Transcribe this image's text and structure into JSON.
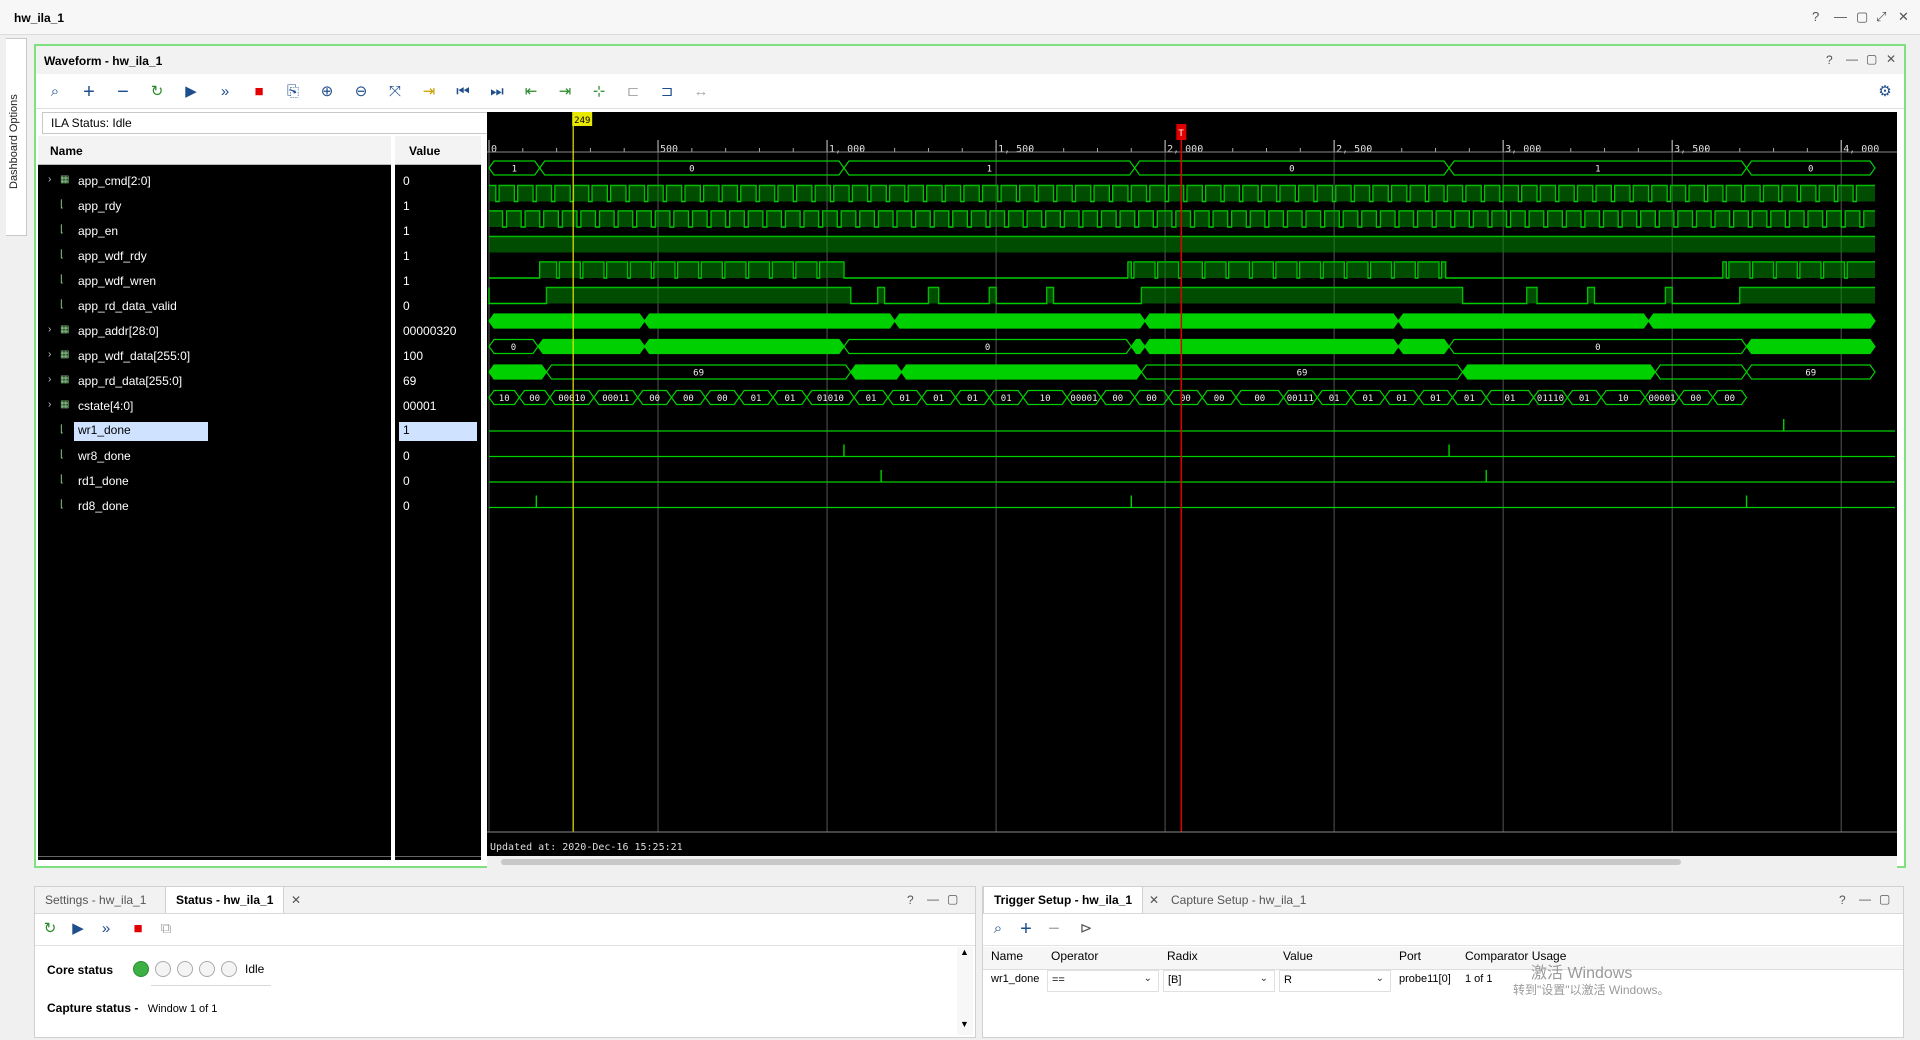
{
  "window": {
    "title": "hw_ila_1"
  },
  "sidebar": {
    "dashboard_tab": "Dashboard Options"
  },
  "waveform": {
    "panel_title": "Waveform - hw_ila_1",
    "ila_status": "ILA Status:  Idle",
    "name_header": "Name",
    "value_header": "Value",
    "signals": [
      {
        "name": "app_cmd[2:0]",
        "value": "0",
        "bus": true
      },
      {
        "name": "app_rdy",
        "value": "1",
        "bus": false
      },
      {
        "name": "app_en",
        "value": "1",
        "bus": false
      },
      {
        "name": "app_wdf_rdy",
        "value": "1",
        "bus": false
      },
      {
        "name": "app_wdf_wren",
        "value": "1",
        "bus": false
      },
      {
        "name": "app_rd_data_valid",
        "value": "0",
        "bus": false
      },
      {
        "name": "app_addr[28:0]",
        "value": "00000320",
        "bus": true
      },
      {
        "name": "app_wdf_data[255:0]",
        "value": "100",
        "bus": true
      },
      {
        "name": "app_rd_data[255:0]",
        "value": "69",
        "bus": true
      },
      {
        "name": "cstate[4:0]",
        "value": "00001",
        "bus": true
      },
      {
        "name": "wr1_done",
        "value": "1",
        "bus": false,
        "selected": true
      },
      {
        "name": "wr8_done",
        "value": "0",
        "bus": false
      },
      {
        "name": "rd1_done",
        "value": "0",
        "bus": false
      },
      {
        "name": "rd8_done",
        "value": "0",
        "bus": false
      }
    ],
    "time_ticks": [
      "0",
      "500",
      "1, 000",
      "1, 500",
      "2, 000",
      "2, 500",
      "3, 000",
      "3, 500",
      "4, 000"
    ],
    "cursor_marker": "249",
    "trigger_marker": "T",
    "updated_at": "Updated at: 2020-Dec-16 15:25:21",
    "bus_labels": {
      "app_cmd": [
        "1",
        "0",
        "1",
        "0",
        "1",
        "0"
      ],
      "app_wdf_data": [
        "0",
        "0",
        "0"
      ],
      "app_rd_data": [
        "69",
        "69",
        "69"
      ],
      "cstate": [
        "10",
        "00",
        "00010",
        "00011",
        "00",
        "00",
        "00",
        "01",
        "01",
        "01010",
        "01",
        "01",
        "01",
        "01",
        "01",
        "10",
        "00001",
        "00",
        "00",
        "00",
        "00",
        "00",
        "00111",
        "01",
        "01",
        "01",
        "01",
        "01",
        "01",
        "01110",
        "01",
        "10",
        "00001",
        "00",
        "00"
      ]
    }
  },
  "settings_panel": {
    "tabs": [
      "Settings - hw_ila_1",
      "Status - hw_ila_1"
    ],
    "core_status_label": "Core status",
    "core_status_value": "Idle",
    "capture_status_label": "Capture status -",
    "capture_status_value": "Window 1 of 1"
  },
  "trigger_panel": {
    "tabs": [
      "Trigger Setup - hw_ila_1",
      "Capture Setup - hw_ila_1"
    ],
    "columns": [
      "Name",
      "Operator",
      "Radix",
      "Value",
      "Port",
      "Comparator Usage"
    ],
    "row": {
      "name": "wr1_done",
      "operator": "==",
      "radix": "[B]",
      "value": "R",
      "port": "probe11[0]",
      "comparator": "1 of 1"
    }
  },
  "watermark": {
    "line1": "激活 Windows",
    "line2": "转到\"设置\"以激活 Windows。"
  },
  "colors": {
    "wave": "#00d000",
    "cursor": "#e8e800",
    "trigger": "#e00000",
    "accent": "#7fe07f"
  }
}
